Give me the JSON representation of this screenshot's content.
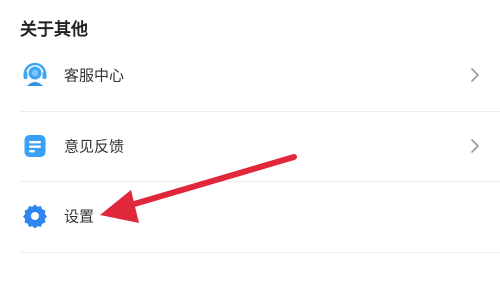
{
  "section": {
    "title": "关于其他"
  },
  "menu": {
    "items": [
      {
        "label": "客服中心",
        "icon": "headset-icon",
        "has_chevron": true
      },
      {
        "label": "意见反馈",
        "icon": "feedback-icon",
        "has_chevron": true
      },
      {
        "label": "设置",
        "icon": "gear-icon",
        "has_chevron": false
      }
    ]
  },
  "colors": {
    "headset_blue": "#3da6f5",
    "feedback_blue": "#3aa0f7",
    "gear_blue": "#2f86f0",
    "annotation_arrow": "#e0283a"
  },
  "annotation": {
    "icon": "red-arrow-pointing-to-settings"
  }
}
